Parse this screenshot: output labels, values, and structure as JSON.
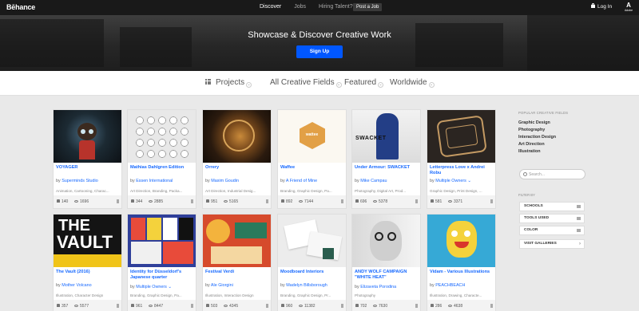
{
  "topbar": {
    "logo": "Bēhance",
    "nav": [
      "Discover",
      "Jobs",
      "Hiring Talent?"
    ],
    "post_job": "Post a Job",
    "login": "Log In",
    "adobe_mark": "A",
    "adobe_text": "Adobe"
  },
  "hero": {
    "title": "Showcase & Discover Creative Work",
    "signup": "Sign Up"
  },
  "filters": [
    "Projects",
    "All Creative Fields",
    "Featured",
    "Worldwide"
  ],
  "cards": [
    {
      "title": "VOYAGER",
      "by": "by",
      "owner": "Superminds Studio",
      "fields": "Animation, Cartooning, Charac...",
      "likes": "140",
      "views": "1696"
    },
    {
      "title": "Mathias Dahlgren Edition",
      "by": "by",
      "owner": "Essen International",
      "fields": "Art Direction, Branding, Packa...",
      "likes": "344",
      "views": "2885"
    },
    {
      "title": "Orrery",
      "by": "by",
      "owner": "Maxim Goudin",
      "fields": "Art Direction, Industrial Desig...",
      "likes": "951",
      "views": "5165"
    },
    {
      "title": "Waffee",
      "by": "by",
      "owner": "A Friend of Mine",
      "fields": "Branding, Graphic Design, Pa...",
      "likes": "892",
      "views": "7144"
    },
    {
      "title": "Under Armour: SWACKET",
      "by": "by",
      "owner": "Mike Campau",
      "fields": "Photography, Digital Art, Prod...",
      "likes": "696",
      "views": "5378"
    },
    {
      "title": "Letterpress Love x Andrei Robu",
      "by": "by",
      "owner": "Multiple Owners",
      "fields": "Graphic Design, Print Design, ...",
      "likes": "581",
      "views": "3371"
    },
    {
      "title": "The Vault (2016)",
      "by": "by",
      "owner": "Mother Volcano",
      "fields": "Illustration, Character Design",
      "likes": "357",
      "views": "5577"
    },
    {
      "title": "Identity for Düsseldorf's Japanese quarter",
      "by": "by",
      "owner": "Multiple Owners",
      "fields": "Branding, Graphic Design, Pa...",
      "likes": "961",
      "views": "8447"
    },
    {
      "title": "Festival Verdi",
      "by": "by",
      "owner": "Ale Giorgini",
      "fields": "Illustration, Interaction Design",
      "likes": "503",
      "views": "4345"
    },
    {
      "title": "Moodboard Interiors",
      "by": "by",
      "owner": "Madelyn Billsborough",
      "fields": "Branding, Graphic Design, Pr...",
      "likes": "960",
      "views": "11382"
    },
    {
      "title": "ANDY WOLF CAMPAIGN \"WHITE HEAT\"",
      "by": "by",
      "owner": "Elizaveta Porodina",
      "fields": "Photography",
      "likes": "702",
      "views": "7630"
    },
    {
      "title": "Vidam - Various Illustrations",
      "by": "by",
      "owner": "PEACHBEACH",
      "fields": "Illustration, Drawing, Characte...",
      "likes": "286",
      "views": "4638"
    }
  ],
  "thumb_text": {
    "waffee": "wattee",
    "swacket": "SWACKET",
    "vault_1": "THE",
    "vault_2": "VAULT"
  },
  "sidebar": {
    "heading": "POPULAR CREATIVE FIELDS",
    "fields": [
      "Graphic Design",
      "Photography",
      "Interaction Design",
      "Art Direction",
      "Illustration"
    ],
    "search_placeholder": "Search...",
    "filter_heading": "FILTER BY",
    "filters": [
      "SCHOOLS",
      "TOOLS USED",
      "COLOR",
      "VISIT GALLERIES"
    ]
  }
}
